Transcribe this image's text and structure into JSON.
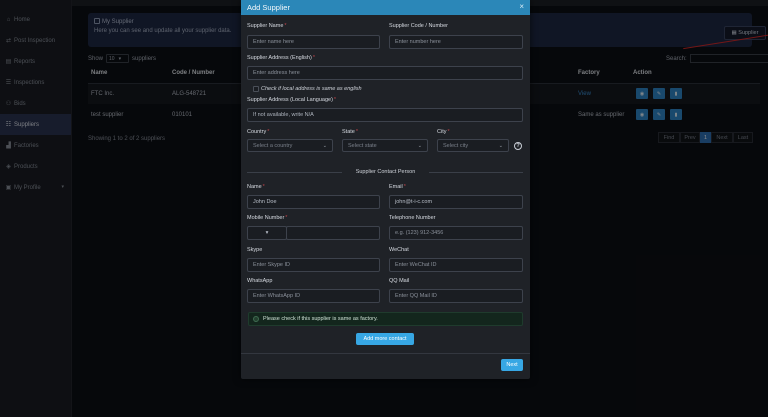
{
  "sidebar": {
    "items": [
      {
        "label": "Home",
        "icon": "home-icon",
        "glyph": "⌂",
        "active": false
      },
      {
        "label": "Post Inspection",
        "icon": "post-inspection-icon",
        "glyph": "⇄",
        "active": false
      },
      {
        "label": "Reports",
        "icon": "reports-icon",
        "glyph": "▤",
        "active": false
      },
      {
        "label": "Inspections",
        "icon": "inspections-icon",
        "glyph": "☰",
        "active": false
      },
      {
        "label": "Bids",
        "icon": "bids-icon",
        "glyph": "⚇",
        "active": false
      },
      {
        "label": "Suppliers",
        "icon": "suppliers-icon",
        "glyph": "☷",
        "active": true
      },
      {
        "label": "Factories",
        "icon": "factories-icon",
        "glyph": "▟",
        "active": false
      },
      {
        "label": "Products",
        "icon": "products-icon",
        "glyph": "◈",
        "active": false
      },
      {
        "label": "My Profile",
        "icon": "profile-icon",
        "glyph": "▣",
        "active": false,
        "has_caret": true
      }
    ]
  },
  "page": {
    "info_title": "My Supplier",
    "info_subtitle": "Here you can see and update all your supplier data.",
    "supplier_button": "▦ Supplier",
    "show_label": "Show",
    "show_value": "10",
    "show_suffix": "suppliers",
    "search_label": "Search:",
    "table": {
      "headers": [
        "Name",
        "Code / Number",
        "Factory",
        "Action"
      ],
      "rows": [
        {
          "name": "FTC Inc.",
          "code": "ALG-548721",
          "factory": "View"
        },
        {
          "name": "test supplier",
          "code": "010101",
          "factory": "Same as supplier"
        }
      ]
    },
    "showing_text": "Showing 1 to 2 of 2 suppliers",
    "pagination": [
      "Find",
      "Prev",
      "1",
      "Next",
      "Last"
    ]
  },
  "modal": {
    "title": "Add Supplier",
    "close": "×",
    "supplier_name": {
      "label": "Supplier Name",
      "placeholder": "Enter name here",
      "required": "*"
    },
    "supplier_code": {
      "label": "Supplier Code / Number",
      "placeholder": "Enter number here"
    },
    "address_en": {
      "label": "Supplier Address (English)",
      "placeholder": "Enter address here",
      "required": "*"
    },
    "same_address_label": "Check if local address is same as english",
    "address_local": {
      "label": "Supplier Address (Local Language)",
      "placeholder": "If not available, write N/A",
      "required": "*"
    },
    "country": {
      "label": "Country",
      "placeholder": "Select a country",
      "required": "*"
    },
    "state": {
      "label": "State",
      "placeholder": "Select state",
      "required": "*"
    },
    "city": {
      "label": "City",
      "placeholder": "Select city",
      "required": "*"
    },
    "help": "?",
    "contact_section": "Supplier Contact Person",
    "contact_name": {
      "label": "Name",
      "value": "John Doe",
      "required": "*"
    },
    "contact_email": {
      "label": "Email",
      "value": "john@t-i-c.com",
      "required": "*"
    },
    "mobile": {
      "label": "Mobile Number",
      "required": "*",
      "code_arrow": "▾"
    },
    "telephone": {
      "label": "Telephone Number",
      "placeholder": "e.g. (123) 912-3456"
    },
    "skype": {
      "label": "Skype",
      "placeholder": "Enter Skype ID"
    },
    "wechat": {
      "label": "WeChat",
      "placeholder": "Enter WeChat ID"
    },
    "whatsapp": {
      "label": "WhatsApp",
      "placeholder": "Enter WhatsApp ID"
    },
    "qqmail": {
      "label": "QQ Mail",
      "placeholder": "Enter QQ Mail ID"
    },
    "factory_check_label": "Please check if this supplier is same as factory.",
    "add_contact_button": "Add more contact",
    "next_button": "Next"
  },
  "colors": {
    "modal_header": "#2b87b8",
    "primary_button": "#37a7e4",
    "sidebar_active": "#2b3350",
    "annotation_arrow": "#d12a2a"
  }
}
